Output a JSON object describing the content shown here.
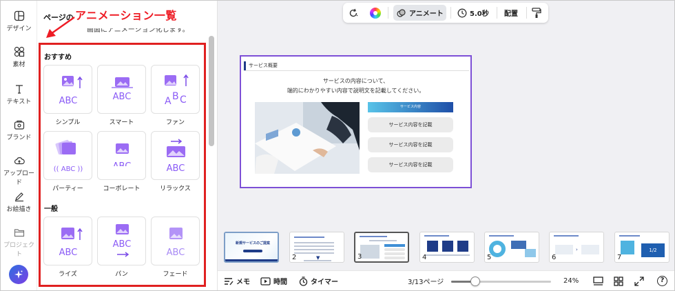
{
  "rail": {
    "items": [
      {
        "label": "デザイン",
        "icon": "layout-icon"
      },
      {
        "label": "素材",
        "icon": "shapes-icon"
      },
      {
        "label": "テキスト",
        "icon": "text-icon"
      },
      {
        "label": "ブランド",
        "icon": "brand-icon"
      },
      {
        "label": "アップロード",
        "icon": "cloud-upload-icon"
      },
      {
        "label": "お絵描き",
        "icon": "pen-icon"
      },
      {
        "label": "プロジェクト",
        "icon": "folder-icon"
      }
    ],
    "magic_icon": "sparkle-icon"
  },
  "panel": {
    "title": "ページの",
    "description": "画面にアニメーション化します。",
    "callout": "アニメーション一覧",
    "section_recommended": "おすすめ",
    "section_general": "一般",
    "recommended": [
      {
        "label": "シンプル",
        "art": "ABC"
      },
      {
        "label": "スマート",
        "art": "ABC"
      },
      {
        "label": "ファン",
        "art": "ABC"
      },
      {
        "label": "パーティー",
        "art": "ABC"
      },
      {
        "label": "コーボレート",
        "art": "ABC"
      },
      {
        "label": "リラックス",
        "art": "ABC"
      }
    ],
    "general": [
      {
        "label": "ライズ",
        "art": "ABC"
      },
      {
        "label": "パン",
        "art": "ABC"
      },
      {
        "label": "フェード",
        "art": "ABC"
      }
    ]
  },
  "toolbar": {
    "animate_label": "アニメート",
    "duration_label": "5.0秒",
    "arrange_label": "配置"
  },
  "slide": {
    "header": "サービス概要",
    "line1": "サービスの内容について、",
    "line2": "端的にわかりやすい内容で説明文を記載してください。",
    "service_head": "サービス内容",
    "service_items": [
      "サービス内容を記載",
      "サービス内容を記載",
      "サービス内容を記載"
    ]
  },
  "thumbnails": {
    "numbers": [
      "1",
      "2",
      "3",
      "4",
      "5",
      "6",
      "7"
    ],
    "thumb1_title": "新規サービスのご提案",
    "thumb7_text": "1/2"
  },
  "bottom": {
    "memo": "メモ",
    "time": "時間",
    "timer": "タイマー",
    "page": "3/13ページ",
    "zoom": "24%",
    "zoom_level": 0.24,
    "help": "?"
  },
  "colors": {
    "accent": "#8b5cf6",
    "callout_red": "#ee1c25",
    "slide_border": "#7d4fd6"
  }
}
